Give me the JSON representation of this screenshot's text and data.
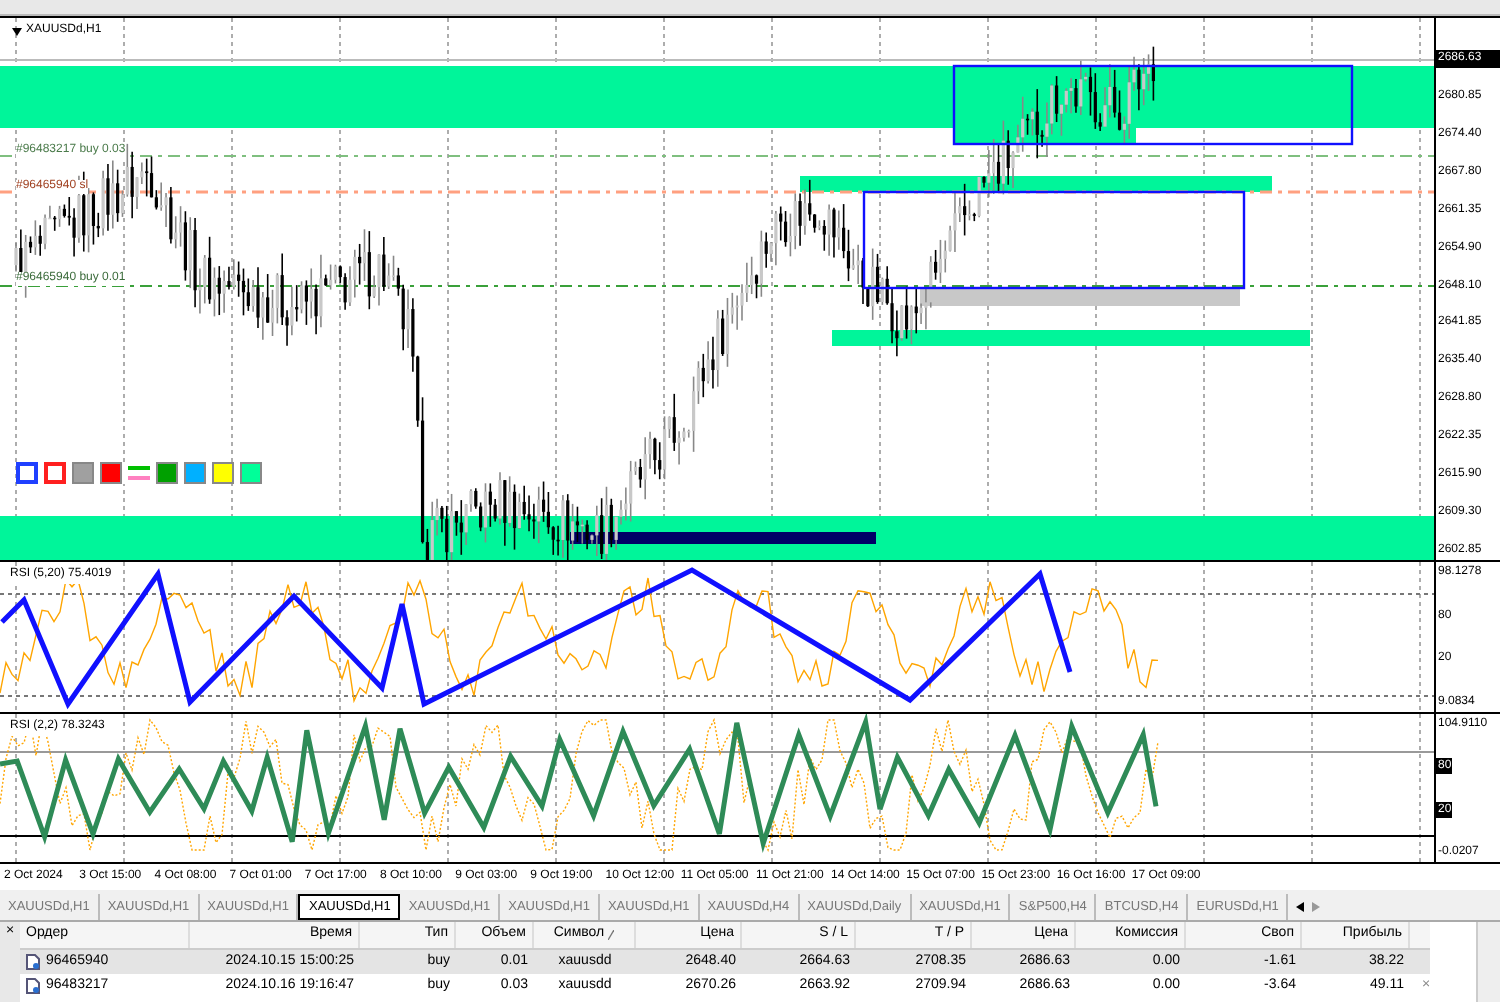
{
  "chart": {
    "title": "XAUUSDd,H1",
    "object_labels": [
      {
        "text": "#96483217 buy 0.03",
        "kind": "tp"
      },
      {
        "text": "#96465940 sl",
        "kind": "sl"
      },
      {
        "text": "#96465940 buy 0.01",
        "kind": "entry"
      }
    ],
    "palette": [
      {
        "color": "#2040ff",
        "kind": "outline"
      },
      {
        "color": "#ff2020",
        "kind": "outline"
      },
      {
        "color": "#a0a0a0",
        "kind": "fill"
      },
      {
        "color": "#ff0000",
        "kind": "fill"
      },
      {
        "color": "#00c000",
        "kind": "lines"
      },
      {
        "color": "#00a000",
        "kind": "fill"
      },
      {
        "color": "#00b0ff",
        "kind": "fill"
      },
      {
        "color": "#ffff00",
        "kind": "fill"
      },
      {
        "color": "#00ff99",
        "kind": "fill"
      }
    ],
    "price_axis": [
      {
        "label": "2686.63",
        "current": true
      },
      {
        "label": "2680.85",
        "current": false
      },
      {
        "label": "2674.40",
        "current": false
      },
      {
        "label": "2667.80",
        "current": false
      },
      {
        "label": "2661.35",
        "current": false
      },
      {
        "label": "2654.90",
        "current": false
      },
      {
        "label": "2648.10",
        "current": false
      },
      {
        "label": "2641.85",
        "current": false
      },
      {
        "label": "2635.40",
        "current": false
      },
      {
        "label": "2628.80",
        "current": false
      },
      {
        "label": "2622.35",
        "current": false
      },
      {
        "label": "2615.90",
        "current": false
      },
      {
        "label": "2609.30",
        "current": false
      },
      {
        "label": "2602.85",
        "current": false
      }
    ]
  },
  "panes": [
    {
      "label": "RSI (5,20) 75.4019",
      "axis": [
        {
          "label": "98.1278",
          "boxed": false
        },
        {
          "label": "80",
          "boxed": false
        },
        {
          "label": "20",
          "boxed": false
        },
        {
          "label": "9.0834",
          "boxed": false
        }
      ]
    },
    {
      "label": "RSI (2,2) 78.3243",
      "axis": [
        {
          "label": "104.9110",
          "boxed": false
        },
        {
          "label": "80",
          "boxed": true
        },
        {
          "label": "20",
          "boxed": true
        },
        {
          "label": "-0.0207",
          "boxed": false
        }
      ]
    }
  ],
  "time_axis": [
    "2 Oct 2024",
    "3 Oct 15:00",
    "4 Oct 08:00",
    "7 Oct 01:00",
    "7 Oct 17:00",
    "8 Oct 10:00",
    "9 Oct 03:00",
    "9 Oct 19:00",
    "10 Oct 12:00",
    "11 Oct 05:00",
    "11 Oct 21:00",
    "14 Oct 14:00",
    "15 Oct 07:00",
    "15 Oct 23:00",
    "16 Oct 16:00",
    "17 Oct 09:00"
  ],
  "tabs": [
    {
      "label": "XAUUSDd,H1",
      "selected": false
    },
    {
      "label": "XAUUSDd,H1",
      "selected": false
    },
    {
      "label": "XAUUSDd,H1",
      "selected": false
    },
    {
      "label": "XAUUSDd,H1",
      "selected": true
    },
    {
      "label": "XAUUSDd,H1",
      "selected": false
    },
    {
      "label": "XAUUSDd,H1",
      "selected": false
    },
    {
      "label": "XAUUSDd,H1",
      "selected": false
    },
    {
      "label": "XAUUSDd,H4",
      "selected": false
    },
    {
      "label": "XAUUSDd,Daily",
      "selected": false
    },
    {
      "label": "XAUUSDd,H1",
      "selected": false
    },
    {
      "label": "S&P500,H4",
      "selected": false
    },
    {
      "label": "BTCUSD,H4",
      "selected": false
    },
    {
      "label": "EURUSDd,H1",
      "selected": false
    }
  ],
  "table": {
    "panel_close": "×",
    "columns": [
      "Ордер",
      "Время",
      "Тип",
      "Объем",
      "Символ",
      "Цена",
      "S / L",
      "T / P",
      "Цена",
      "Комиссия",
      "Своп",
      "Прибыль"
    ],
    "rows": [
      {
        "selected": true,
        "cells": [
          "96465940",
          "2024.10.15 15:00:25",
          "buy",
          "0.01",
          "xauusdd",
          "2648.40",
          "2664.63",
          "2708.35",
          "2686.63",
          "0.00",
          "-1.61",
          "38.22"
        ]
      },
      {
        "selected": false,
        "cells": [
          "96483217",
          "2024.10.16 19:16:47",
          "buy",
          "0.03",
          "xauusdd",
          "2670.26",
          "2663.92",
          "2709.94",
          "2686.63",
          "0.00",
          "-3.64",
          "49.11"
        ],
        "close_label": "×"
      }
    ]
  }
}
